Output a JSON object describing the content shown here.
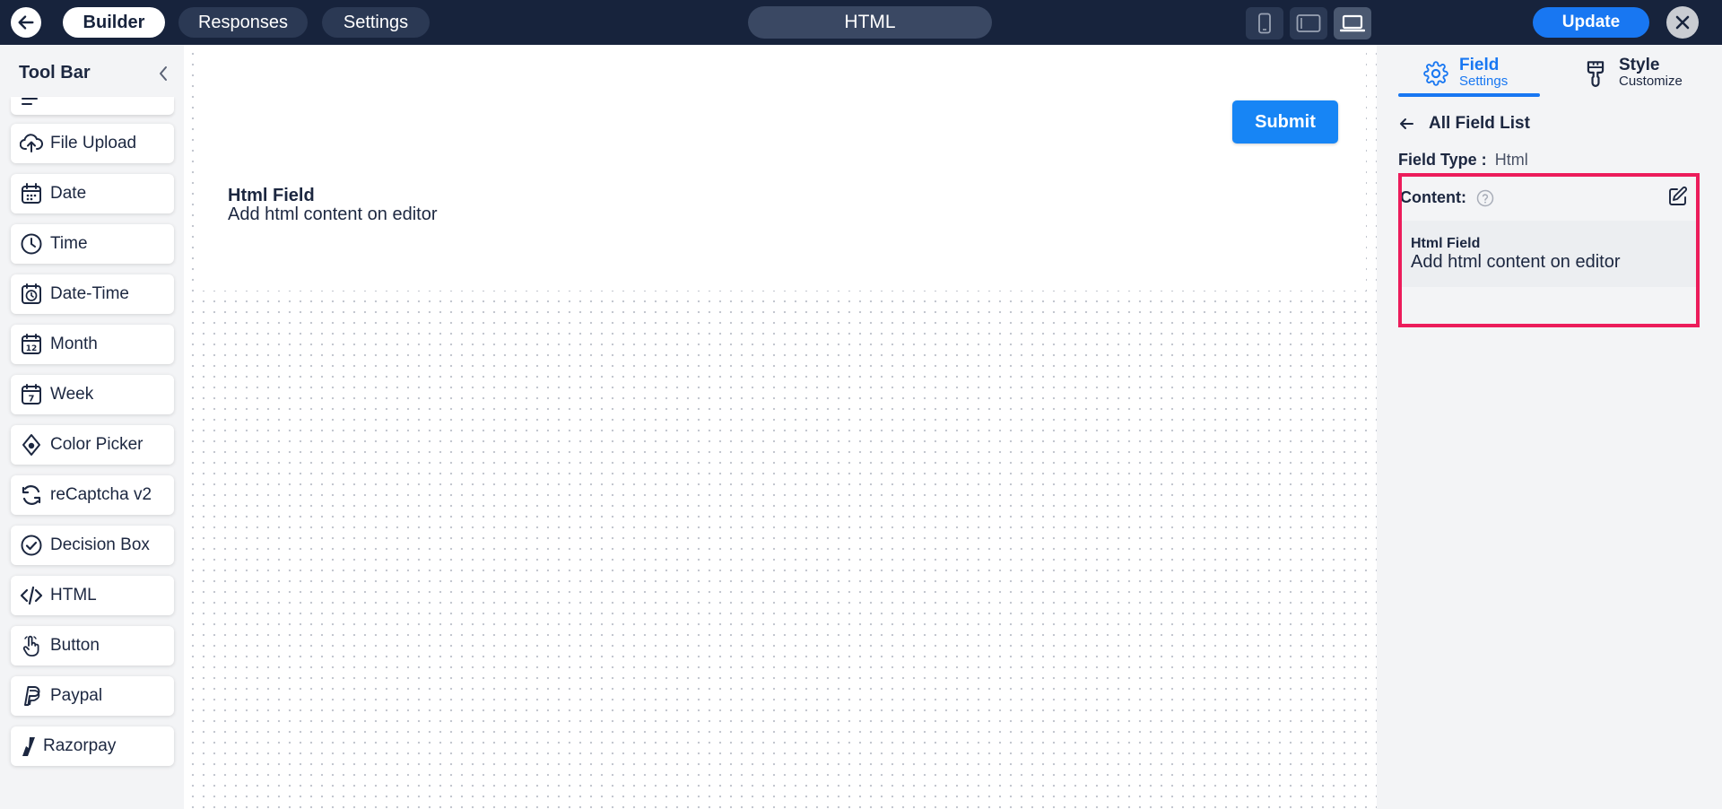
{
  "topbar": {
    "tabs": [
      {
        "label": "Builder",
        "active": true
      },
      {
        "label": "Responses",
        "active": false
      },
      {
        "label": "Settings",
        "active": false
      }
    ],
    "title": "HTML",
    "update_label": "Update",
    "device_modes": [
      "mobile-icon",
      "tablet-icon",
      "laptop-icon"
    ],
    "active_device": "laptop-icon"
  },
  "toolbar": {
    "title": "Tool Bar",
    "items": [
      {
        "label": "File Upload",
        "icon": "upload-icon"
      },
      {
        "label": "Date",
        "icon": "calendar-icon"
      },
      {
        "label": "Time",
        "icon": "clock-icon"
      },
      {
        "label": "Date-Time",
        "icon": "date-time-icon"
      },
      {
        "label": "Month",
        "icon": "month-calendar-icon"
      },
      {
        "label": "Week",
        "icon": "week-calendar-icon"
      },
      {
        "label": "Color Picker",
        "icon": "color-drop-icon"
      },
      {
        "label": "reCaptcha v2",
        "icon": "recaptcha-icon"
      },
      {
        "label": "Decision Box",
        "icon": "check-circle-icon"
      },
      {
        "label": "HTML",
        "icon": "code-icon"
      },
      {
        "label": "Button",
        "icon": "pointer-hand-icon"
      },
      {
        "label": "Paypal",
        "icon": "paypal-icon"
      },
      {
        "label": "Razorpay",
        "icon": "razorpay-icon"
      }
    ]
  },
  "canvas": {
    "submit_label": "Submit",
    "html_field_title": "Html Field",
    "html_field_desc": "Add html content on editor"
  },
  "panel": {
    "tabs": [
      {
        "main": "Field",
        "sub": "Settings",
        "icon": "gear-icon",
        "active": true
      },
      {
        "main": "Style",
        "sub": "Customize",
        "icon": "paint-brush-icon",
        "active": false
      }
    ],
    "all_field_list": "All Field List",
    "field_type_label": "Field Type :",
    "field_type_value": "Html",
    "content_label": "Content:",
    "preview_title": "Html Field",
    "preview_desc": "Add html content on editor"
  },
  "colors": {
    "topbar_bg": "#17233c",
    "accent_blue": "#1877f2",
    "highlight": "#ec1c5b",
    "panel_bg": "#f3f4f6"
  }
}
